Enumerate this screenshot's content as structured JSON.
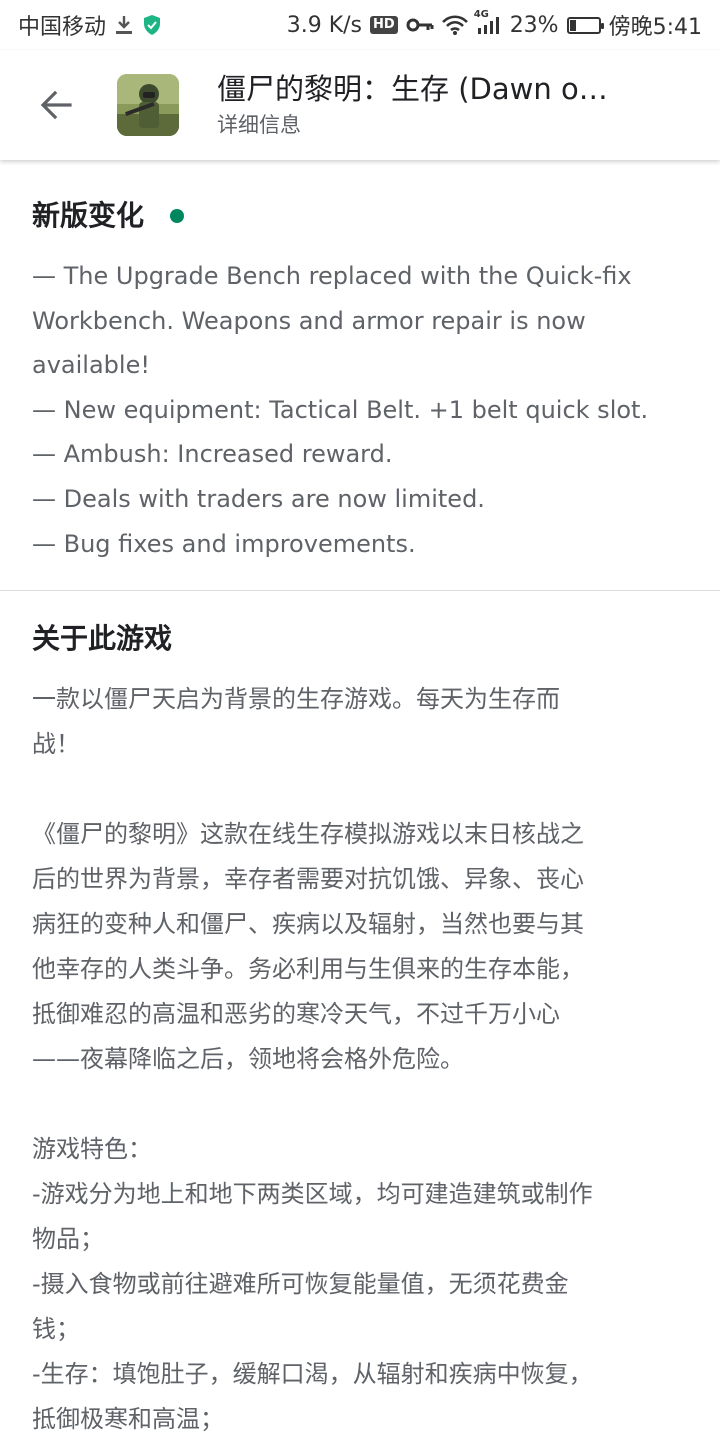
{
  "status_bar": {
    "carrier": "中国移动",
    "speed": "3.9 K/s",
    "hd": "HD",
    "network": "4G",
    "battery": "23%",
    "battery_level": 0.23,
    "time": "傍晚5:41"
  },
  "app_bar": {
    "title": "僵尸的黎明：生存 (Dawn o…",
    "subtitle": "详细信息"
  },
  "whats_new": {
    "heading": "新版变化",
    "dot_color": "#01875f",
    "lines": [
      "— The Upgrade Bench replaced with the Quick-fix",
      "Workbench. Weapons and armor repair is now",
      "available!",
      "— New equipment: Tactical Belt. +1 belt quick slot.",
      "— Ambush: Increased reward.",
      "— Deals with traders are now limited.",
      "— Bug fixes and improvements."
    ]
  },
  "about": {
    "heading": "关于此游戏",
    "lines": [
      "一款以僵尸天启为背景的生存游戏。每天为生存而",
      "战！",
      "",
      "《僵尸的黎明》这款在线生存模拟游戏以末日核战之",
      "后的世界为背景，幸存者需要对抗饥饿、异象、丧心",
      "病狂的变种人和僵尸、疾病以及辐射，当然也要与其",
      "他幸存的人类斗争。务必利用与生俱来的生存本能，",
      "抵御难忍的高温和恶劣的寒冷天气，不过千万小心",
      "——夜幕降临之后，领地将会格外危险。",
      "",
      "游戏特色：",
      "-游戏分为地上和地下两类区域，均可建造建筑或制作",
      "物品；",
      "-摄入食物或前往避难所可恢复能量值，无须花费金",
      "钱；",
      "-生存：填饱肚子，缓解口渴，从辐射和疾病中恢复，",
      "抵御极寒和高温；"
    ]
  }
}
